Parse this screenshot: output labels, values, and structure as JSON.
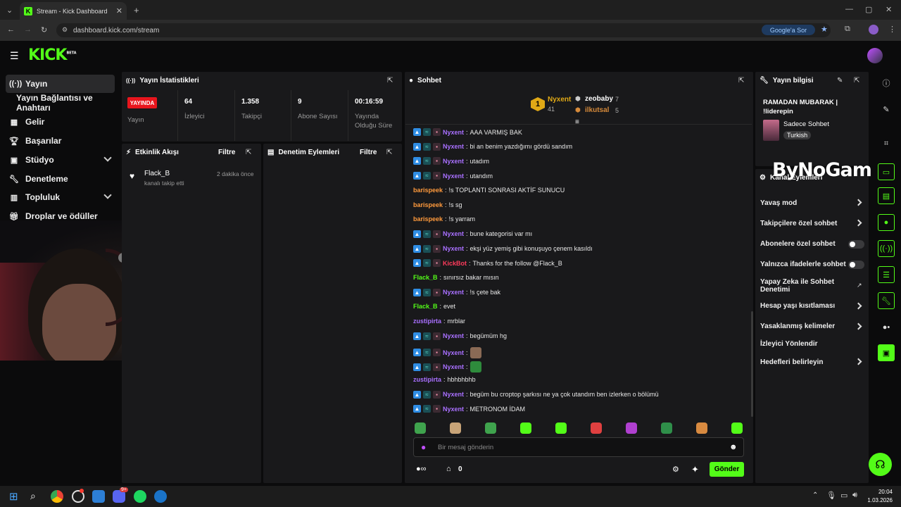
{
  "browser": {
    "tab_title": "Stream - Kick Dashboard",
    "url": "dashboard.kick.com/stream",
    "google_btn": "Google'a Sor"
  },
  "app": {
    "logo": "KICK",
    "logo_badge": "BETA"
  },
  "sidebar": {
    "items": [
      {
        "label": "Yayın",
        "icon": "broadcast-icon"
      },
      {
        "label": "Yayın Bağlantısı ve Anahtarı",
        "icon": ""
      },
      {
        "label": "Gelir",
        "icon": "revenue-icon"
      },
      {
        "label": "Başarılar",
        "icon": "trophy-icon"
      },
      {
        "label": "Stüdyo",
        "icon": "studio-icon"
      },
      {
        "label": "Denetleme",
        "icon": "wrench-icon"
      },
      {
        "label": "Topluluk",
        "icon": "community-icon"
      },
      {
        "label": "Droplar ve ödüller",
        "icon": "gift-icon"
      }
    ]
  },
  "stats": {
    "title": "Yayın İstatistikleri",
    "live_badge": "YAYINDA",
    "items": [
      {
        "value": "",
        "label": "Yayın"
      },
      {
        "value": "64",
        "label": "İzleyici"
      },
      {
        "value": "1.358",
        "label": "Takipçi"
      },
      {
        "value": "9",
        "label": "Abone Sayısı"
      },
      {
        "value": "00:16:59",
        "label": "Yayında Olduğu Süre"
      }
    ]
  },
  "activity": {
    "title": "Etkinlik Akışı",
    "filter": "Filtre",
    "events": [
      {
        "user": "Flack_B",
        "action": "kanalı takip etti",
        "time": "2 dakika önce"
      }
    ]
  },
  "moderation": {
    "title": "Denetim Eylemleri",
    "filter": "Filtre"
  },
  "chat": {
    "title": "Sohbet",
    "leaders": [
      {
        "rank": "1",
        "name": "Nyxent",
        "count": "41"
      },
      {
        "name": "zeobaby",
        "count": "7"
      },
      {
        "name": "ilkutsal",
        "count": "5"
      }
    ],
    "messages": [
      {
        "user": "Nyxent",
        "text": "AAA VARMIŞ BAK",
        "color": "#a970ff",
        "badges": true
      },
      {
        "user": "Nyxent",
        "text": "bi an benim yazdığımı gördü sandım",
        "color": "#a970ff",
        "badges": true
      },
      {
        "user": "Nyxent",
        "text": "utadım",
        "color": "#a970ff",
        "badges": true
      },
      {
        "user": "Nyxent",
        "text": "utandım",
        "color": "#a970ff",
        "badges": true
      },
      {
        "user": "barispeek",
        "text": "!s TOPLANTI SONRASI AKTİF SUNUCU",
        "color": "#ff9a3c",
        "badges": false
      },
      {
        "user": "barispeek",
        "text": "!s sg",
        "color": "#ff9a3c",
        "badges": false
      },
      {
        "user": "barispeek",
        "text": "!s yarram",
        "color": "#ff9a3c",
        "badges": false
      },
      {
        "user": "Nyxent",
        "text": "bune kategorisi var mı",
        "color": "#a970ff",
        "badges": true
      },
      {
        "user": "Nyxent",
        "text": "ekşi yüz yemiş gibi konuşuyo çenem kasıldı",
        "color": "#a970ff",
        "badges": true
      },
      {
        "user": "KickBot",
        "text": "Thanks for the follow @Flack_B",
        "color": "#ff3b5c",
        "badges": true
      },
      {
        "user": "Flack_B",
        "text": "sınırsız bakar mısın",
        "color": "#53fc18",
        "badges": false
      },
      {
        "user": "Nyxent",
        "text": "!s çete bak",
        "color": "#a970ff",
        "badges": true
      },
      {
        "user": "Flack_B",
        "text": "evet",
        "color": "#53fc18",
        "badges": false
      },
      {
        "user": "zustipirta",
        "text": "mrblar",
        "color": "#a970ff",
        "badges": false
      },
      {
        "user": "Nyxent",
        "text": "begümüm hg",
        "color": "#a970ff",
        "badges": true
      },
      {
        "user": "Nyxent",
        "text": "",
        "color": "#a970ff",
        "badges": true,
        "emote": "#8a6a55"
      },
      {
        "user": "Nyxent",
        "text": "",
        "color": "#a970ff",
        "badges": true,
        "emote": "#2e8b3c"
      },
      {
        "user": "zustipirta",
        "text": "hbhbhbhb",
        "color": "#a970ff",
        "badges": false
      },
      {
        "user": "Nyxent",
        "text": "begüm bu croptop şarkısı ne ya çok utandım ben izlerken o bölümü",
        "color": "#a970ff",
        "badges": true
      },
      {
        "user": "Nyxent",
        "text": "METRONOM İDAM",
        "color": "#a970ff",
        "badges": true
      }
    ],
    "input_placeholder": "Bir mesaj gönderin",
    "points": "0",
    "send": "Gönder"
  },
  "stream_info": {
    "title": "Yayın bilgisi",
    "stream_title": "RAMADAN MUBARAK | !liderepin",
    "category": "Sadece Sohbet",
    "tag": "Turkish"
  },
  "channel_actions": {
    "title": "Kanal Eylemleri",
    "items": [
      {
        "label": "Yavaş mod",
        "control": "chevron"
      },
      {
        "label": "Takipçilere özel sohbet",
        "control": "chevron"
      },
      {
        "label": "Abonelere özel sohbet",
        "control": "toggle"
      },
      {
        "label": "Yalnızca ifadelerle sohbet",
        "control": "toggle"
      },
      {
        "label": "Yapay Zeka ile Sohbet Denetimi",
        "control": "external"
      },
      {
        "label": "Hesap yaşı kısıtlaması",
        "control": "chevron"
      },
      {
        "label": "Yasaklanmış kelimeler",
        "control": "chevron"
      },
      {
        "label": "İzleyici Yönlendir",
        "control": "none"
      },
      {
        "label": "Hedefleri belirleyin",
        "control": "chevron"
      }
    ]
  },
  "watermark": "ByNoGame",
  "taskbar": {
    "time": "20:04",
    "date": "1.03.2026",
    "badge": "9+"
  },
  "colors": {
    "accent": "#53fc18",
    "live": "#e8151d",
    "panel": "#19191b"
  }
}
